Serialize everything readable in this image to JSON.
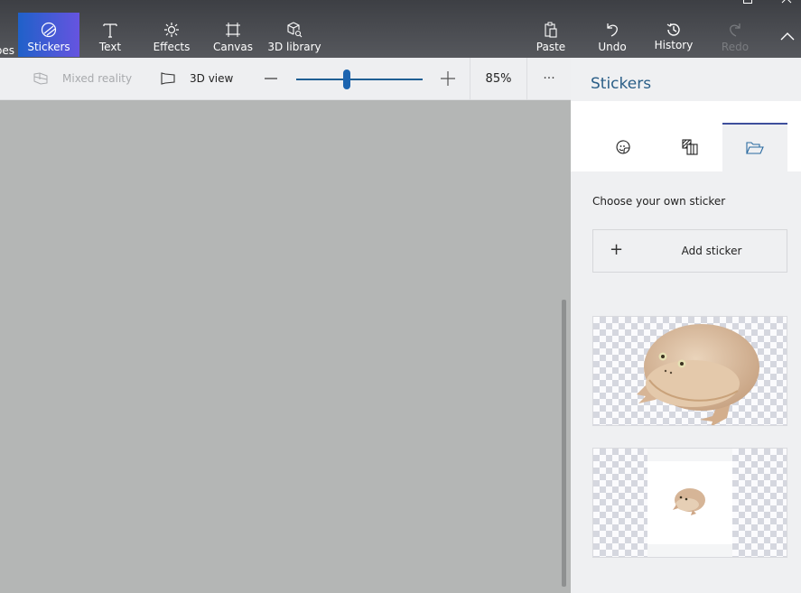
{
  "ribbon": {
    "tabs": [
      {
        "id": "shapes",
        "label": "pes",
        "icon": "shapes-icon",
        "state": "partial"
      },
      {
        "id": "stickers",
        "label": "Stickers",
        "icon": "sticker-icon",
        "state": "active"
      },
      {
        "id": "text",
        "label": "Text",
        "icon": "text-icon",
        "state": "normal"
      },
      {
        "id": "effects",
        "label": "Effects",
        "icon": "sun-icon",
        "state": "normal"
      },
      {
        "id": "canvas",
        "label": "Canvas",
        "icon": "crop-icon",
        "state": "normal"
      },
      {
        "id": "3d-library",
        "label": "3D library",
        "icon": "cube-search-icon",
        "state": "normal"
      }
    ],
    "actions": [
      {
        "id": "paste",
        "label": "Paste",
        "icon": "paste-icon",
        "enabled": true
      },
      {
        "id": "undo",
        "label": "Undo",
        "icon": "undo-icon",
        "enabled": true
      },
      {
        "id": "history",
        "label": "History",
        "icon": "history-icon",
        "enabled": true
      },
      {
        "id": "redo",
        "label": "Redo",
        "icon": "redo-icon",
        "enabled": false
      }
    ],
    "collapse_icon": "chevron-up-icon",
    "active_gradient": [
      "#1f61c9",
      "#6654e0"
    ]
  },
  "toolbar": {
    "mixed_reality": {
      "label": "Mixed reality",
      "enabled": false
    },
    "view_3d": {
      "label": "3D view",
      "enabled": true
    },
    "zoom": {
      "value_percent": 85,
      "label": "85%",
      "slider_fraction": 0.4
    },
    "more_label": "···"
  },
  "pane": {
    "title": "Stickers",
    "tabs": [
      {
        "id": "stickers",
        "icon": "sticker-face-icon",
        "active": false
      },
      {
        "id": "textures",
        "icon": "texture-icon",
        "active": false
      },
      {
        "id": "custom",
        "icon": "folder-open-icon",
        "active": true
      }
    ],
    "choose_label": "Choose your own sticker",
    "add_button": {
      "plus": "+",
      "label": "Add sticker"
    },
    "stickers": [
      {
        "id": "frog-large",
        "description": "frog sticker (large)"
      },
      {
        "id": "frog-small",
        "description": "frog sticker (small, white background)"
      }
    ]
  }
}
